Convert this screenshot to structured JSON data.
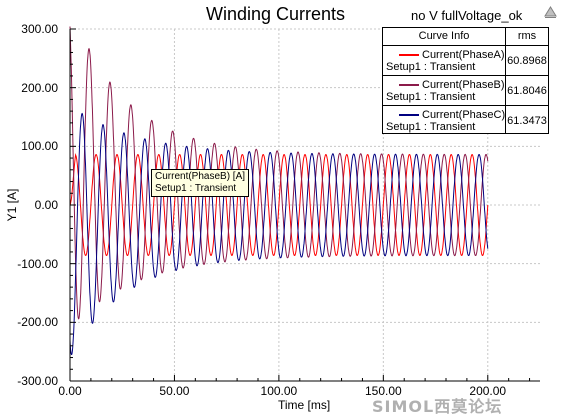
{
  "chart_data": {
    "type": "line",
    "title": "Winding Currents",
    "subtitle": "no V fullVoltage_ok",
    "xlabel": "Time [ms]",
    "ylabel": "Y1 [A]",
    "xlim": [
      0,
      225
    ],
    "ylim": [
      -300,
      300
    ],
    "x_ticks": [
      "0.00",
      "50.00",
      "100.00",
      "150.00",
      "200.00"
    ],
    "y_ticks": [
      "300.00",
      "200.00",
      "100.00",
      "0.00",
      "-100.00",
      "-200.00",
      "-300.00"
    ],
    "grid": true,
    "legend_placement": "top-right",
    "legend_header": {
      "curve": "Curve Info",
      "rms": "rms"
    },
    "series": [
      {
        "name": "Current(PhaseA)",
        "setup": "Setup1 : Transient",
        "rms": "60.8968",
        "color": "#ff0000",
        "steady_amplitude": 86,
        "initial_peak": 86,
        "phase_deg": 0,
        "frequency_hz": 100,
        "t_end_ms": 200
      },
      {
        "name": "Current(PhaseB)",
        "setup": "Setup1 : Transient",
        "rms": "61.8046",
        "color": "#8b1a4a",
        "steady_amplitude": 86,
        "initial_peak": 275,
        "phase_deg": 120,
        "frequency_hz": 100,
        "t_end_ms": 200
      },
      {
        "name": "Current(PhaseC)",
        "setup": "Setup1 : Transient",
        "rms": "61.3473",
        "color": "#000080",
        "steady_amplitude": 86,
        "initial_peak": 215,
        "phase_deg": 240,
        "frequency_hz": 100,
        "t_end_ms": 200
      }
    ]
  },
  "tooltip": {
    "line1": "Current(PhaseB) [A]",
    "line2": "Setup1 : Transient"
  },
  "corner_icon": "arrow-up-icon",
  "watermark": "SIMOL西莫论坛"
}
